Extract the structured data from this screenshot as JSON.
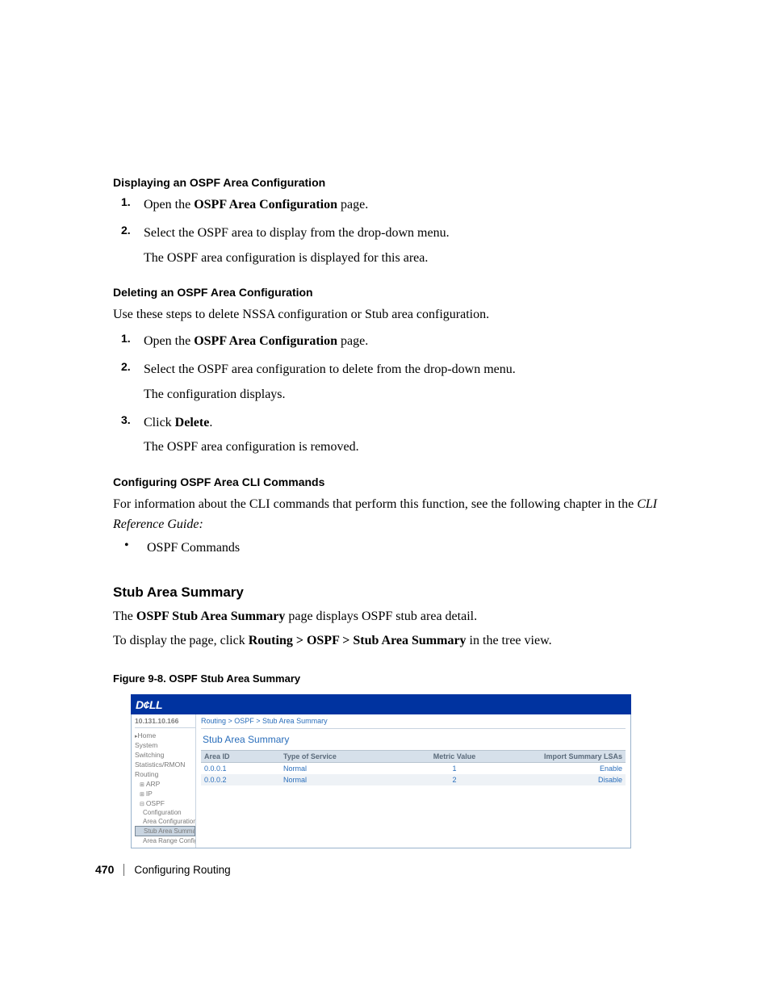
{
  "sec1": {
    "title": "Displaying an OSPF Area Configuration",
    "step1_a": "Open the ",
    "step1_b": "OSPF Area Configuration",
    "step1_c": " page.",
    "step2_a": "Select the OSPF area to display from the drop-down menu.",
    "step2_b": "The OSPF area configuration is displayed for this area."
  },
  "sec2": {
    "title": "Deleting an OSPF Area Configuration",
    "intro": "Use these steps to delete NSSA configuration or Stub area configuration.",
    "step1_a": "Open the ",
    "step1_b": "OSPF Area Configuration",
    "step1_c": " page.",
    "step2_a": "Select the OSPF area configuration to delete from the drop-down menu.",
    "step2_b": "The configuration displays.",
    "step3_a": "Click ",
    "step3_b": "Delete",
    "step3_c": ".",
    "step3_d": "The OSPF area configuration is removed."
  },
  "sec3": {
    "title": "Configuring OSPF Area CLI Commands",
    "line_a": "For information about the CLI commands that perform this function, see the following chapter in the ",
    "line_b": "CLI Reference Guide:",
    "bullet": "OSPF Commands"
  },
  "sec4": {
    "title": "Stub Area Summary",
    "p1_a": "The ",
    "p1_b": "OSPF Stub Area Summary",
    "p1_c": " page displays OSPF stub area detail.",
    "p2_a": "To display the page, click ",
    "p2_b": "Routing > OSPF > Stub Area Summary",
    "p2_c": " in the tree view."
  },
  "figure": {
    "caption": "Figure 9-8.    OSPF Stub Area Summary"
  },
  "screenshot": {
    "logo": "D¢LL",
    "ip": "10.131.10.166",
    "nav": {
      "home": "Home",
      "system": "System",
      "switching": "Switching",
      "stats": "Statistics/RMON",
      "routing": "Routing",
      "arp": "ARP",
      "ip": "IP",
      "ospf": "OSPF",
      "configuration": "Configuration",
      "area_config": "Area Configuration",
      "stub_area": "Stub Area Summary",
      "area_range": "Area Range Configu"
    },
    "breadcrumb": "Routing > OSPF > Stub Area Summary",
    "panel_title": "Stub Area Summary",
    "headers": {
      "area_id": "Area ID",
      "tos": "Type of Service",
      "metric": "Metric Value",
      "import": "Import Summary LSAs"
    },
    "rows": [
      {
        "area_id": "0.0.0.1",
        "tos": "Normal",
        "metric": "1",
        "import": "Enable"
      },
      {
        "area_id": "0.0.0.2",
        "tos": "Normal",
        "metric": "2",
        "import": "Disable"
      }
    ]
  },
  "footer": {
    "page": "470",
    "section": "Configuring Routing"
  },
  "nums": {
    "n1": "1.",
    "n2": "2.",
    "n3": "3."
  },
  "bullets": {
    "dot": "•"
  }
}
